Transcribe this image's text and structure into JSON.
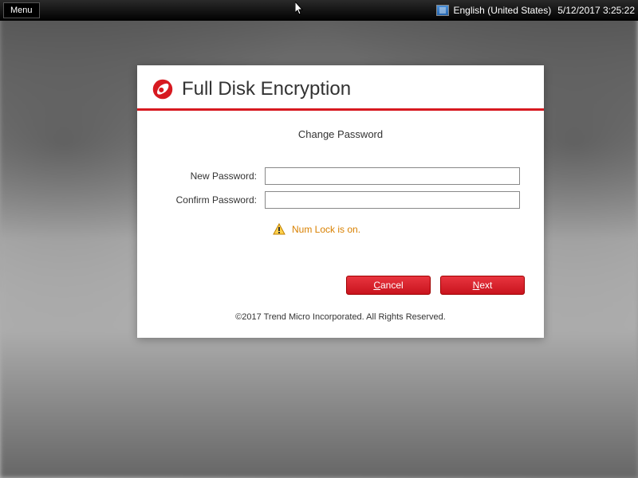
{
  "topbar": {
    "menu_label": "Menu",
    "language": "English (United States)",
    "datetime": "5/12/2017 3:25:22"
  },
  "dialog": {
    "title": "Full Disk Encryption",
    "subtitle": "Change Password",
    "labels": {
      "new_password": "New Password:",
      "confirm_password": "Confirm Password:"
    },
    "values": {
      "new_password": "",
      "confirm_password": ""
    },
    "warning": "Num Lock is on.",
    "buttons": {
      "cancel": "Cancel",
      "cancel_key": "C",
      "next": "Next",
      "next_key": "N"
    },
    "footer": "©2017 Trend Micro Incorporated. All Rights Reserved."
  },
  "colors": {
    "brand_red": "#d71920",
    "warn_orange": "#d98000"
  }
}
